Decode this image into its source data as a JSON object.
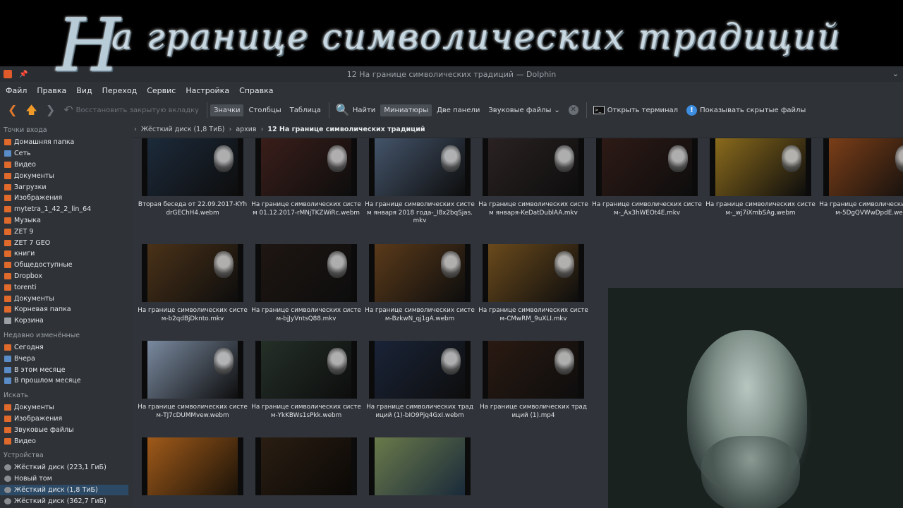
{
  "banner": {
    "initial": "Н",
    "text": "а границе символических традиций"
  },
  "window": {
    "title": "12 На границе символических традиций — Dolphin"
  },
  "menu": [
    "Файл",
    "Правка",
    "Вид",
    "Переход",
    "Сервис",
    "Настройка",
    "Справка"
  ],
  "toolbar": {
    "restore_tab": "Восстановить закрытую вкладку",
    "icons": "Значки",
    "columns": "Столбцы",
    "table": "Таблица",
    "find": "Найти",
    "thumbnails": "Миниатюры",
    "two_panels": "Две панели",
    "sound_files": "Звуковые файлы",
    "open_terminal": "Открыть терминал",
    "show_hidden": "Показывать скрытые файлы"
  },
  "sidebar": {
    "places_header": "Точки входа",
    "places": [
      "Домашняя папка",
      "Сеть",
      "Видео",
      "Документы",
      "Загрузки",
      "Изображения",
      "mytetra_1_42_2_lin_64",
      "Музыка",
      "ZET 9",
      "ZET 7 GEO",
      "книги",
      "Общедоступные",
      "Dropbox",
      "torenti",
      "Документы",
      "Корневая папка",
      "Корзина"
    ],
    "recent_header": "Недавно изменённые",
    "recent": [
      "Сегодня",
      "Вчера",
      "В этом месяце",
      "В прошлом месяце"
    ],
    "search_header": "Искать",
    "search": [
      "Документы",
      "Изображения",
      "Звуковые файлы",
      "Видео"
    ],
    "devices_header": "Устройства",
    "devices": [
      "Жёсткий диск (223,1 ГиБ)",
      "Новый том",
      "Жёсткий диск (1,8 ТиБ)",
      "Жёсткий диск (362,7 ГиБ)"
    ]
  },
  "breadcrumb": {
    "disk": "Жёсткий диск (1,8 ТиБ)",
    "archive": "архив",
    "current": "12 На границе символических традиций"
  },
  "files": [
    {
      "name": "Вторая беседа от 22.09.2017-KYhdrGEChH4.webm",
      "bg": "#1c2a3a"
    },
    {
      "name": "На границе символических систем  01.12.2017-rMNjTKZWiRc.webm",
      "bg": "#3a1e1a"
    },
    {
      "name": "На границе символических систем  января 2018 года-_I8x2bqSjas.mkv",
      "bg": "#44546a"
    },
    {
      "name": "На границе символических систем  января-KeDatDublAA.mkv",
      "bg": "#2a2222"
    },
    {
      "name": "На границе символических систем-_Ax3hWEOt4E.mkv",
      "bg": "#2e1a16"
    },
    {
      "name": "На границе символических систем-_wj7iXmbSAg.webm",
      "bg": "#8a6a1c"
    },
    {
      "name": "На границе символических систем-5DgQVWwDpdE.webm",
      "bg": "#7a3e18"
    },
    {
      "name": "На границе символических систем-b2qdBjDknto.mkv",
      "bg": "#4a3218"
    },
    {
      "name": "На границе символических систем-bjJyVntsQ88.mkv",
      "bg": "#1e1612"
    },
    {
      "name": "На границе символических систем-BzkwN_qj1gA.webm",
      "bg": "#5a3a1a"
    },
    {
      "name": "На границе символических систем-CMwRM_9uXLI.mkv",
      "bg": "#6a4a1c"
    },
    {
      "name": "На границе символических систем-TJ7cDUMMvew.webm",
      "bg": "#7a8aa0"
    },
    {
      "name": "На границе символических систем-YkKBWs1sPkk.webm",
      "bg": "#243028"
    },
    {
      "name": "На границе символических традиций (1)-bIO9Pjq4GxI.webm",
      "bg": "#1a2438"
    },
    {
      "name": "На границе символических традиций (1).mp4",
      "bg": "#2a1a12"
    }
  ]
}
